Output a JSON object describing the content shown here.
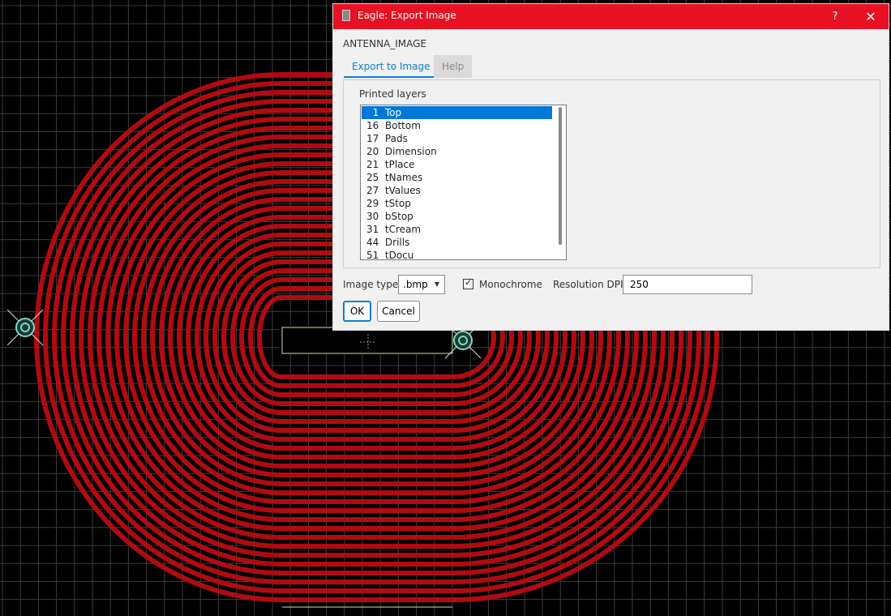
{
  "window": {
    "title": "Eagle: Export Image",
    "help_symbol": "?",
    "close_symbol": "✕"
  },
  "heading": "ANTENNA_IMAGE",
  "tabs": [
    {
      "label": "Export to Image"
    },
    {
      "label": "Help"
    }
  ],
  "printed_layers": {
    "label": "Printed layers",
    "items": [
      "  1  Top",
      "16  Bottom",
      "17  Pads",
      "20  Dimension",
      "21  tPlace",
      "25  tNames",
      "27  tValues",
      "29  tStop",
      "30  bStop",
      "31  tCream",
      "44  Drills",
      "51  tDocu"
    ],
    "selected_index": 0
  },
  "image_type": {
    "label": "Image type",
    "value": ".bmp"
  },
  "monochrome": {
    "label": "Monochrome",
    "checked": true
  },
  "resolution": {
    "label": "Resolution DPI",
    "value": "250"
  },
  "buttons": {
    "ok": "OK",
    "cancel": "Cancel"
  },
  "colors": {
    "trace": "#b00b10",
    "grid": "#3d3d3d",
    "title_bar": "#e81123",
    "accent": "#0e7fd1",
    "outline": "#c9e5a5"
  }
}
